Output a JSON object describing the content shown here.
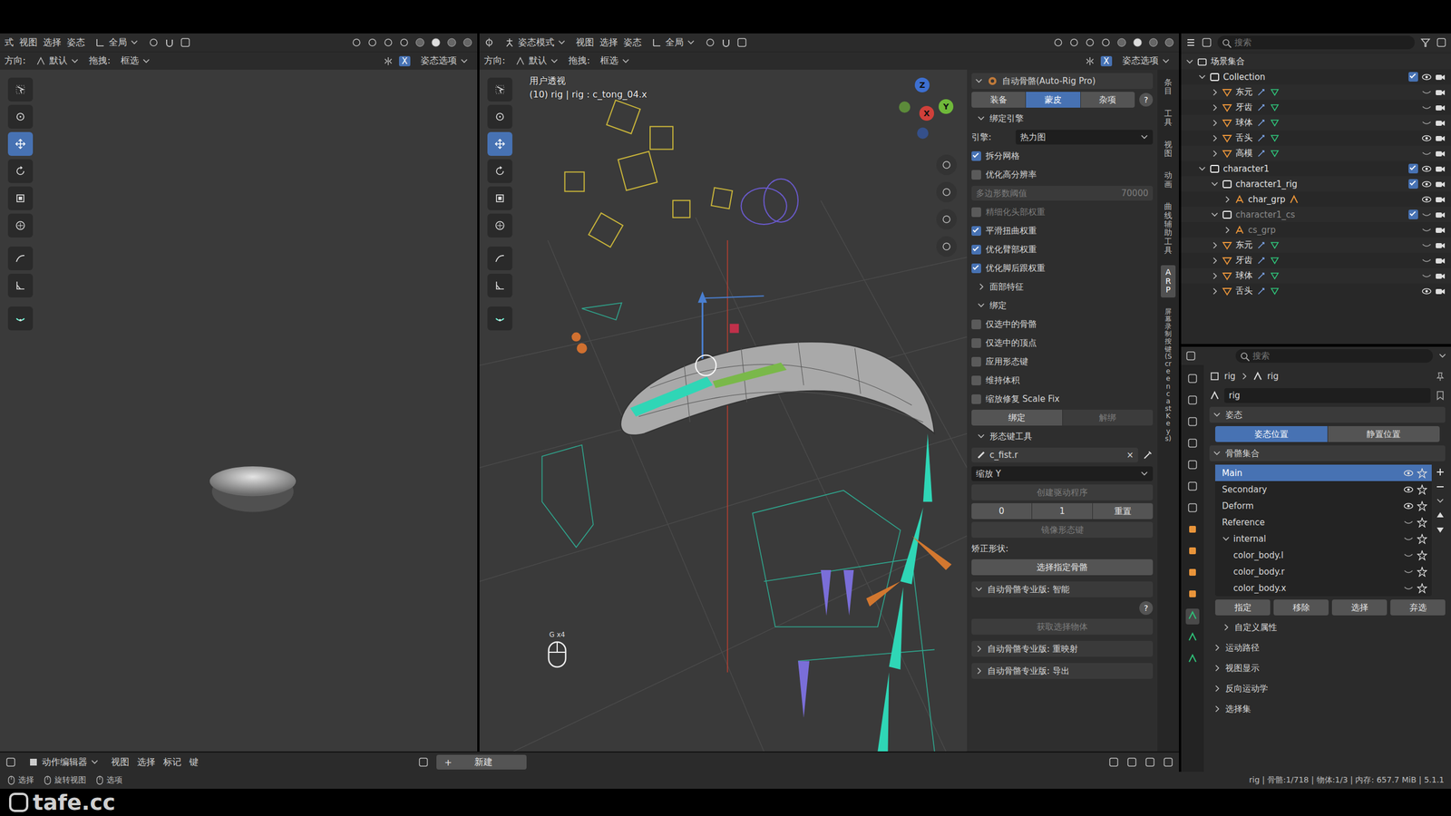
{
  "left_header": {
    "menus": [
      "式",
      "视图",
      "选择",
      "姿态"
    ],
    "transform": "全局",
    "orient_label": "方向:",
    "orient": "默认",
    "drag_label": "拖拽:",
    "drag": "框选",
    "mirror": "X",
    "options": "姿态选项"
  },
  "main_header": {
    "mode": "姿态模式",
    "menus": [
      "视图",
      "选择",
      "姿态"
    ],
    "transform": "全局",
    "orient_label": "方向:",
    "orient": "默认",
    "drag_label": "拖拽:",
    "drag": "框选",
    "mirror": "X",
    "options": "姿态选项"
  },
  "viewport": {
    "view_name": "用户透视",
    "info": "(10) rig | rig : c_tong_04.x",
    "gizmo": {
      "z": "Z",
      "y": "Y",
      "x": "X"
    },
    "key_hint": "G x4"
  },
  "side_tabs": [
    {
      "label": "条目",
      "selected": false
    },
    {
      "label": "工具",
      "selected": false
    },
    {
      "label": "视图",
      "selected": false
    },
    {
      "label": "动画",
      "selected": false
    },
    {
      "label": "曲线辅助工具",
      "selected": false
    },
    {
      "label": "ARP",
      "selected": true
    },
    {
      "label": "屏幕录制按键 (Screencast Keys)",
      "selected": false
    }
  ],
  "arp": {
    "title": "自动骨骼(Auto-Rig Pro)",
    "help": "?",
    "tabs": [
      {
        "label": "装备",
        "selected": false
      },
      {
        "label": "蒙皮",
        "selected": true
      },
      {
        "label": "杂项",
        "selected": false
      }
    ],
    "rows": [
      {
        "kind": "section",
        "label": "绑定引擎",
        "expanded": true
      },
      {
        "kind": "select",
        "label": "引擎:",
        "value": "热力图"
      },
      {
        "kind": "check",
        "label": "拆分网格",
        "checked": true,
        "disabled": false
      },
      {
        "kind": "check",
        "label": "优化高分辨率",
        "checked": false,
        "disabled": false
      },
      {
        "kind": "number",
        "label": "多边形数阈值",
        "value": "70000",
        "disabled": true
      },
      {
        "kind": "check",
        "label": "精细化头部权重",
        "checked": false,
        "disabled": true
      },
      {
        "kind": "check",
        "label": "平滑扭曲权重",
        "checked": true,
        "disabled": false
      },
      {
        "kind": "check",
        "label": "优化臂部权重",
        "checked": true,
        "disabled": false
      },
      {
        "kind": "check",
        "label": "优化脚后跟权重",
        "checked": true,
        "disabled": false
      },
      {
        "kind": "section",
        "label": "面部特征",
        "expanded": false
      },
      {
        "kind": "section",
        "label": "绑定",
        "expanded": true
      },
      {
        "kind": "check",
        "label": "仅选中的骨骼",
        "checked": false,
        "disabled": false
      },
      {
        "kind": "check",
        "label": "仅选中的顶点",
        "checked": false,
        "disabled": false
      },
      {
        "kind": "check",
        "label": "应用形态键",
        "checked": false,
        "disabled": false
      },
      {
        "kind": "check",
        "label": "维持体积",
        "checked": false,
        "disabled": false
      },
      {
        "kind": "check",
        "label": "缩放修复 Scale Fix",
        "checked": false,
        "disabled": false
      },
      {
        "kind": "pair",
        "items": [
          {
            "label": "绑定",
            "disabled": false
          },
          {
            "label": "解绑",
            "disabled": true
          }
        ]
      },
      {
        "kind": "section",
        "label": "形态键工具",
        "expanded": true
      },
      {
        "kind": "search",
        "value": "c_fist.r",
        "clear": "×"
      },
      {
        "kind": "dropdown",
        "value": "缩放 Y"
      },
      {
        "kind": "button",
        "label": "创建驱动程序",
        "disabled": true
      },
      {
        "kind": "triple",
        "items": [
          "0",
          "1",
          "重置"
        ]
      },
      {
        "kind": "button",
        "label": "镜像形态键",
        "disabled": true
      },
      {
        "kind": "label",
        "label": "矫正形状:"
      },
      {
        "kind": "button",
        "label": "选择指定骨骼",
        "disabled": false
      },
      {
        "kind": "panel",
        "label": "自动骨骼专业版: 智能",
        "expanded": true
      },
      {
        "kind": "help",
        "label": "?"
      },
      {
        "kind": "button",
        "label": "获取选择物体",
        "disabled": true
      },
      {
        "kind": "panel",
        "label": "自动骨骼专业版: 重映射",
        "expanded": false
      },
      {
        "kind": "panel",
        "label": "自动骨骼专业版: 导出",
        "expanded": false
      }
    ]
  },
  "outliner": {
    "search": "搜索",
    "rows": [
      {
        "label": "场景集合",
        "depth": 0,
        "kind": "scene",
        "dimmed": false
      },
      {
        "label": "Collection",
        "depth": 1,
        "kind": "collection",
        "expanded": true,
        "checked": true,
        "visible": true,
        "dimmed": false
      },
      {
        "label": "东元",
        "depth": 2,
        "kind": "object",
        "expanded": false,
        "visible": false,
        "dimmed": false
      },
      {
        "label": "牙齿",
        "depth": 2,
        "kind": "object",
        "expanded": false,
        "visible": false,
        "dimmed": false
      },
      {
        "label": "球体",
        "depth": 2,
        "kind": "object",
        "expanded": false,
        "visible": false,
        "dimmed": false
      },
      {
        "label": "舌头",
        "depth": 2,
        "kind": "object",
        "expanded": false,
        "visible": true,
        "dimmed": false
      },
      {
        "label": "高模",
        "depth": 2,
        "kind": "object",
        "expanded": false,
        "visible": false,
        "dimmed": false
      },
      {
        "label": "character1",
        "depth": 1,
        "kind": "collection",
        "expanded": true,
        "checked": true,
        "visible": true,
        "dimmed": false
      },
      {
        "label": "character1_rig",
        "depth": 2,
        "kind": "collection",
        "expanded": true,
        "checked": true,
        "visible": true,
        "dimmed": false
      },
      {
        "label": "char_grp",
        "depth": 3,
        "kind": "empty",
        "expanded": false,
        "visible": true,
        "dimmed": false
      },
      {
        "label": "character1_cs",
        "depth": 2,
        "kind": "collection",
        "expanded": true,
        "checked": true,
        "visible": false,
        "dimmed": true
      },
      {
        "label": "cs_grp",
        "depth": 3,
        "kind": "empty",
        "expanded": false,
        "visible": false,
        "dimmed": true
      },
      {
        "label": "东元",
        "depth": 2,
        "kind": "object",
        "expanded": false,
        "visible": false,
        "dimmed": false
      },
      {
        "label": "牙齿",
        "depth": 2,
        "kind": "object",
        "expanded": false,
        "visible": false,
        "dimmed": false
      },
      {
        "label": "球体",
        "depth": 2,
        "kind": "object",
        "expanded": false,
        "visible": false,
        "dimmed": false
      },
      {
        "label": "舌头",
        "depth": 2,
        "kind": "object",
        "expanded": false,
        "visible": true,
        "dimmed": false
      }
    ]
  },
  "properties": {
    "search": "搜索",
    "breadcrumb": [
      "rig",
      "rig"
    ],
    "name": "rig",
    "pose_section": "姿态",
    "pose_buttons": [
      {
        "label": "姿态位置",
        "selected": true
      },
      {
        "label": "静置位置",
        "selected": false
      }
    ],
    "collections_section": "骨骼集合",
    "collections": [
      {
        "name": "Main",
        "depth": 0,
        "selected": true,
        "visible": true
      },
      {
        "name": "Secondary",
        "depth": 0,
        "selected": false,
        "visible": true
      },
      {
        "name": "Deform",
        "depth": 0,
        "selected": false,
        "visible": true
      },
      {
        "name": "Reference",
        "depth": 0,
        "selected": false,
        "visible": false
      },
      {
        "name": "internal",
        "depth": 0,
        "selected": false,
        "visible": false,
        "expanded": true
      },
      {
        "name": "color_body.l",
        "depth": 1,
        "selected": false,
        "visible": false
      },
      {
        "name": "color_body.r",
        "depth": 1,
        "selected": false,
        "visible": false
      },
      {
        "name": "color_body.x",
        "depth": 1,
        "selected": false,
        "visible": false
      }
    ],
    "buttons": [
      "指定",
      "移除",
      "选择",
      "弃选"
    ],
    "sections": [
      "自定义属性",
      "运动路径",
      "视图显示",
      "反向运动学",
      "选择集"
    ]
  },
  "timeline": {
    "editor": "动作编辑器",
    "menus": [
      "视图",
      "选择",
      "标记",
      "键"
    ],
    "new_icon": "+",
    "new": "新建"
  },
  "status_bar": {
    "hints": [
      "选择",
      "旋转视图",
      "选项"
    ],
    "info": "rig | 骨骼:1/718 | 物体:1/3 | 内存: 657.7 MiB | 5.1.1"
  },
  "watermark": "tafe.cc"
}
